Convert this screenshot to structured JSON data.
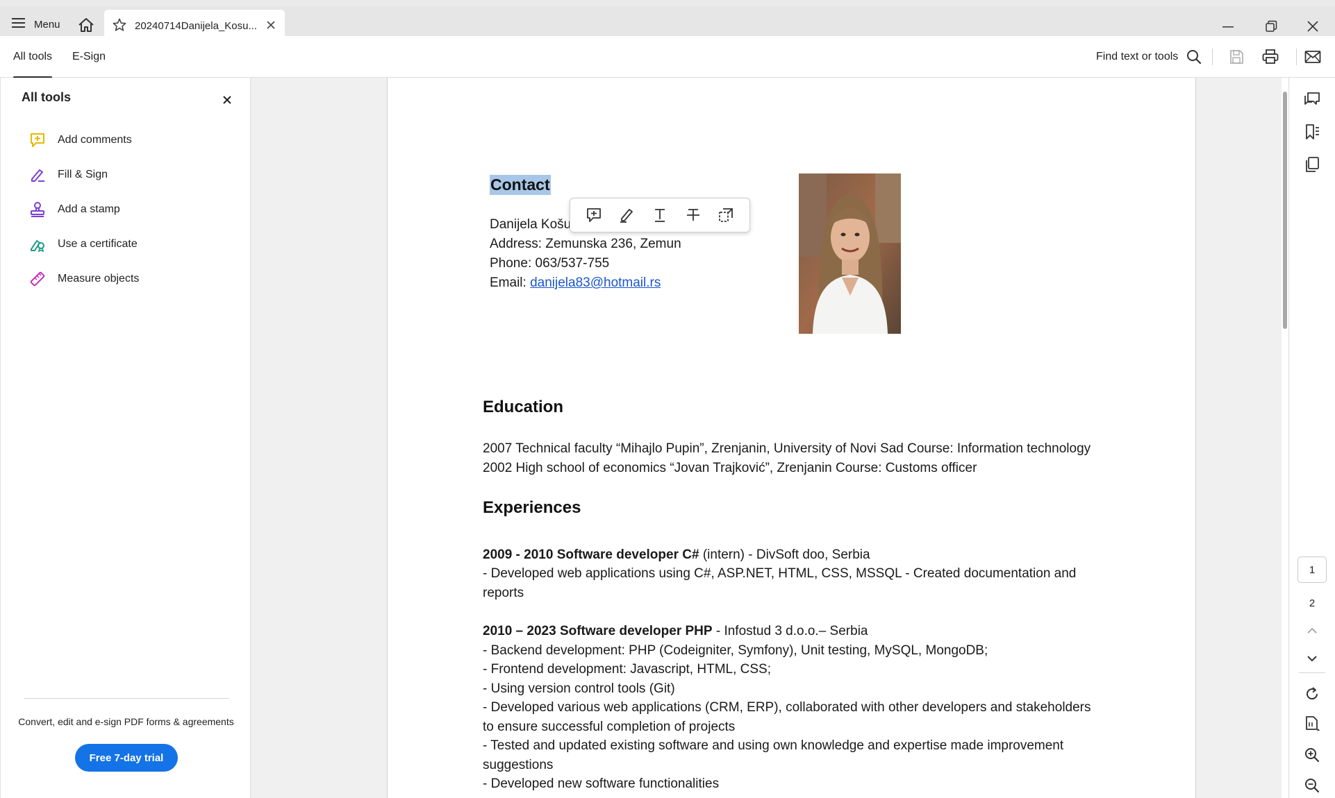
{
  "titlebar": {
    "menu_label": "Menu",
    "tab_title": "20240714Danijela_Kosu..."
  },
  "toolbar": {
    "tabs": [
      {
        "label": "All tools",
        "active": true
      },
      {
        "label": "E-Sign",
        "active": false
      }
    ],
    "find_label": "Find text or tools"
  },
  "left_panel": {
    "title": "All tools",
    "items": [
      {
        "label": "Add comments",
        "icon": "add-comment-icon",
        "color": "#e8b800"
      },
      {
        "label": "Fill & Sign",
        "icon": "fill-sign-icon",
        "color": "#7b3fd4"
      },
      {
        "label": "Add a stamp",
        "icon": "stamp-icon",
        "color": "#7b3fd4"
      },
      {
        "label": "Use a certificate",
        "icon": "certificate-icon",
        "color": "#1a9a8a"
      },
      {
        "label": "Measure objects",
        "icon": "measure-icon",
        "color": "#c22fb5"
      }
    ],
    "promo_text": "Convert, edit and e-sign PDF forms & agreements",
    "trial_button": "Free 7-day trial"
  },
  "document": {
    "contact_heading": "Contact",
    "name_line": "Danijela Košu",
    "address_line": "Address: Zemunska 236, Zemun",
    "phone_line": "Phone: 063/537-755",
    "email_prefix": "Email: ",
    "email": "danijela83@hotmail.rs",
    "education_heading": "Education",
    "education": [
      "2007 Technical faculty “Mihajlo Pupin”, Zrenjanin, University of Novi Sad Course: Information technology",
      "2002 High school of economics “Jovan Trajković”, Zrenjanin Course: Customs officer"
    ],
    "experiences_heading": "Experiences",
    "job1_title": "2009 - 2010 Software developer C#",
    "job1_rest": " (intern) - DivSoft doo, Serbia",
    "job1_lines": [
      "- Developed web applications using C#, ASP.NET, HTML, CSS, MSSQL - Created documentation and",
      "reports"
    ],
    "job2_title": "2010 – 2023 Software developer PHP",
    "job2_rest": " - Infostud 3 d.o.o.– Serbia",
    "job2_lines": [
      "- Backend development: PHP (Codeigniter, Symfony), Unit testing, MySQL, MongoDB;",
      "- Frontend development: Javascript, HTML, CSS;",
      "- Using version control tools (Git)",
      "- Developed various web applications (CRM, ERP), collaborated with other developers and stakeholders",
      "to ensure successful completion of projects",
      "- Tested and updated existing software and using own knowledge and expertise made improvement",
      "suggestions",
      "- Developed new software functionalities"
    ]
  },
  "right_rail": {
    "current_page": "1",
    "next_page": "2"
  },
  "colors": {
    "accent": "#1473e6",
    "highlight": "#a8c7e8",
    "link": "#1b56c9"
  }
}
